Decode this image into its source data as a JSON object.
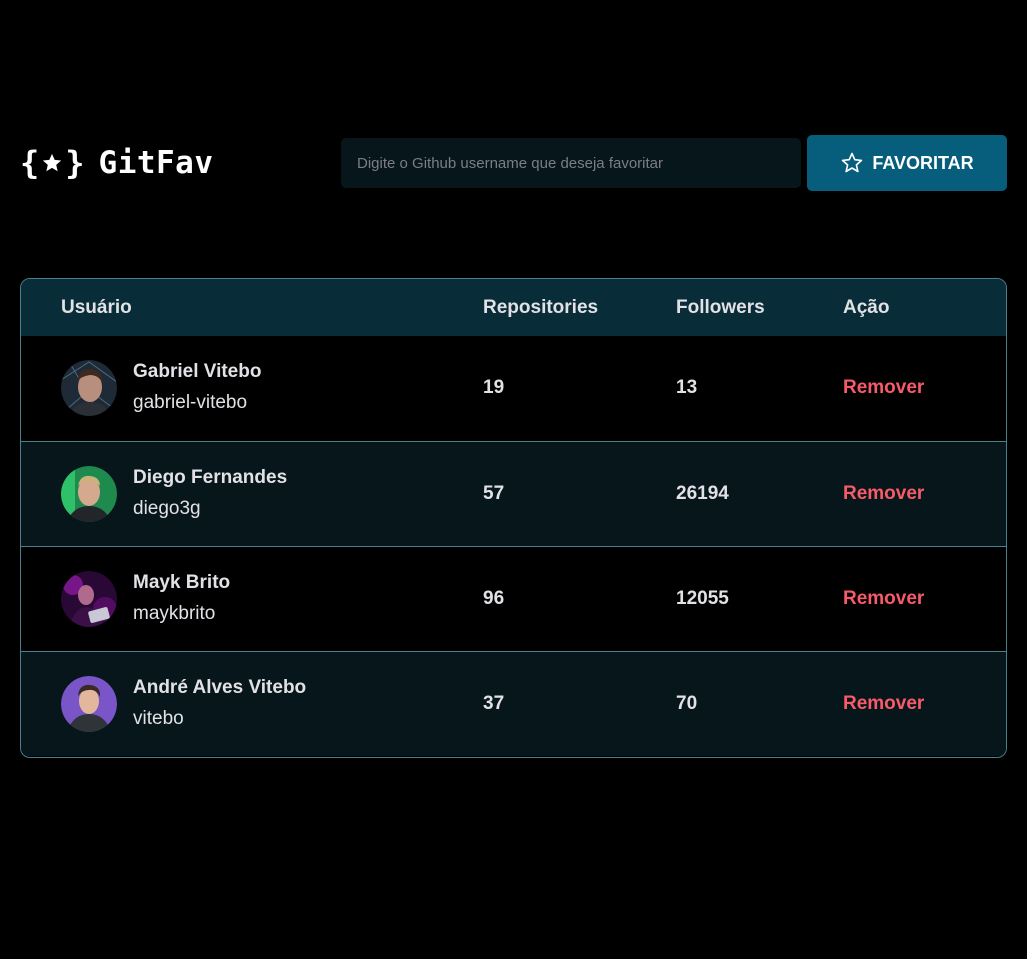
{
  "header": {
    "logo_text": "GitFav",
    "logo_icon": "star-braces-icon",
    "search": {
      "placeholder": "Digite o Github username que deseja favoritar",
      "value": ""
    },
    "favorite_button": {
      "label": "FAVORITAR",
      "icon": "star-outline-icon"
    }
  },
  "colors": {
    "background": "#000000",
    "table_header": "#092D38",
    "row_alt": "#06161B",
    "border": "#4A808C",
    "button": "#065E7C",
    "remove": "#F75A68",
    "text": "#E1E1E6"
  },
  "table": {
    "headers": {
      "user": "Usuário",
      "repositories": "Repositories",
      "followers": "Followers",
      "action": "Ação"
    },
    "rows": [
      {
        "name": "Gabriel Vitebo",
        "login": "gabriel-vitebo",
        "repositories": "19",
        "followers": "13",
        "action": "Remover",
        "avatar_icon": "avatar-gabriel"
      },
      {
        "name": "Diego Fernandes",
        "login": "diego3g",
        "repositories": "57",
        "followers": "26194",
        "action": "Remover",
        "avatar_icon": "avatar-diego"
      },
      {
        "name": "Mayk Brito",
        "login": "maykbrito",
        "repositories": "96",
        "followers": "12055",
        "action": "Remover",
        "avatar_icon": "avatar-mayk"
      },
      {
        "name": "André Alves Vitebo",
        "login": "vitebo",
        "repositories": "37",
        "followers": "70",
        "action": "Remover",
        "avatar_icon": "avatar-andre"
      }
    ]
  }
}
